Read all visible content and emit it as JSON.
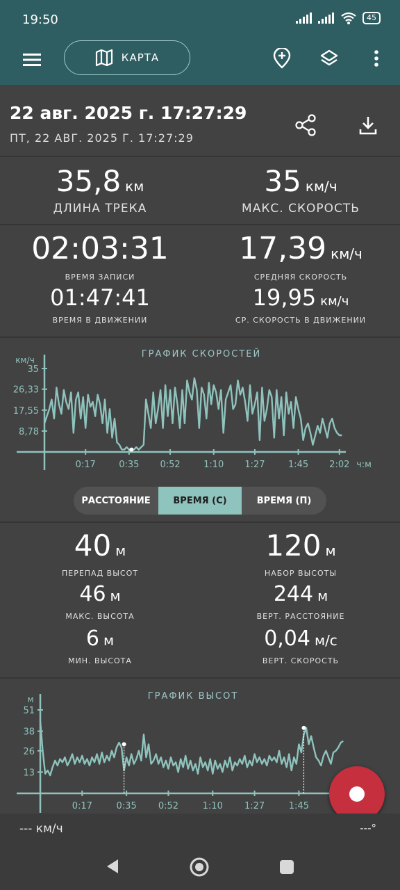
{
  "status": {
    "time": "19:50",
    "battery": "45"
  },
  "appbar": {
    "map_label": "КАРТА",
    "icons": [
      "menu-icon",
      "map-icon",
      "add-location-icon",
      "layers-icon",
      "more-vert-icon"
    ]
  },
  "header": {
    "title": "22 авг. 2025 г. 17:27:29",
    "subtitle": "ПТ, 22 АВГ. 2025 Г. 17:27:29"
  },
  "stats": {
    "distance": {
      "value": "35,8",
      "unit": "км",
      "label": "ДЛИНА ТРЕКА"
    },
    "max_speed": {
      "value": "35",
      "unit": "км/ч",
      "label": "МАКС. СКОРОСТЬ"
    },
    "rec_time": {
      "value": "02:03:31",
      "label": "ВРЕМЯ ЗАПИСИ"
    },
    "avg_speed": {
      "value": "17,39",
      "unit": "км/ч",
      "label": "СРЕДНЯЯ СКОРОСТЬ"
    },
    "moving_time": {
      "value": "01:47:41",
      "label": "ВРЕМЯ В ДВИЖЕНИИ"
    },
    "moving_avg": {
      "value": "19,95",
      "unit": "км/ч",
      "label": "СР. СКОРОСТЬ В ДВИЖЕНИИ"
    }
  },
  "speed_chart_title": "ГРАФИК СКОРОСТЕЙ",
  "segmented": {
    "distance": "РАССТОЯНИЕ",
    "time_s": "ВРЕМЯ (С)",
    "time_p": "ВРЕМЯ (П)"
  },
  "elevation": {
    "diff": {
      "value": "40",
      "unit": "м",
      "label": "ПЕРЕПАД ВЫСОТ"
    },
    "gain": {
      "value": "120",
      "unit": "м",
      "label": "НАБОР ВЫСОТЫ"
    },
    "max": {
      "value": "46",
      "unit": "м",
      "label": "МАКС. ВЫСОТА"
    },
    "vdist": {
      "value": "244",
      "unit": "м",
      "label": "ВЕРТ. РАССТОЯНИЕ"
    },
    "min": {
      "value": "6",
      "unit": "м",
      "label": "МИН. ВЫСОТА"
    },
    "vspeed": {
      "value": "0,04",
      "unit": "м/с",
      "label": "ВЕРТ. СКОРОСТЬ"
    }
  },
  "elevation_chart_title": "ГРАФИК ВЫСОТ",
  "bottom": {
    "speed": "--- км/ч",
    "heading": "---°"
  },
  "chart_data": [
    {
      "type": "line",
      "title": "ГРАФИК СКОРОСТЕЙ",
      "ylabel": "км/ч",
      "xlabel": "ч:м",
      "y_ticks": [
        "35",
        "26,33",
        "17,55",
        "8,78"
      ],
      "x_ticks": [
        "0:17",
        "0:35",
        "0:52",
        "1:10",
        "1:27",
        "1:45",
        "2:02"
      ],
      "ylim": [
        0,
        35
      ],
      "xlim_minutes": [
        0,
        123.5
      ],
      "color": "#8fc3bd",
      "series": [
        {
          "x": [
            0,
            2,
            3,
            4,
            5,
            6,
            7,
            8,
            9,
            10,
            11,
            12,
            13,
            14,
            15,
            16,
            17,
            18,
            19,
            20,
            21,
            22,
            23,
            24,
            25,
            26,
            27,
            28,
            29,
            30,
            31,
            32,
            33,
            34,
            35,
            36,
            37,
            38,
            39,
            40,
            41,
            42,
            43,
            44,
            45,
            46,
            47,
            48,
            49,
            50,
            51,
            52,
            53,
            54,
            55,
            56,
            57,
            58,
            59,
            60,
            61,
            62,
            63,
            64,
            65,
            66,
            67,
            68,
            69,
            70,
            71,
            72,
            73,
            74,
            75,
            76,
            77,
            78,
            79,
            80,
            81,
            82,
            83,
            84,
            85,
            86,
            87,
            88,
            89,
            90,
            91,
            92,
            93,
            94,
            95,
            96,
            97,
            98,
            99,
            100,
            101,
            102,
            103,
            104,
            105,
            106,
            107,
            108,
            109,
            110,
            111,
            112,
            113,
            114,
            115,
            116,
            117,
            118,
            119,
            120,
            121,
            122,
            123
          ],
          "values": [
            12,
            18,
            22,
            14,
            27,
            20,
            16,
            26,
            21,
            18,
            25,
            8,
            22,
            25,
            14,
            23,
            10,
            24,
            19,
            21,
            15,
            24,
            20,
            12,
            22,
            8,
            18,
            6,
            14,
            4,
            3,
            1,
            1,
            2,
            1,
            1,
            1,
            2,
            1,
            2,
            3,
            22,
            16,
            10,
            25,
            12,
            18,
            26,
            10,
            28,
            15,
            26,
            12,
            27,
            20,
            10,
            26,
            12,
            30,
            25,
            22,
            31,
            26,
            10,
            27,
            24,
            14,
            29,
            20,
            28,
            25,
            18,
            26,
            8,
            22,
            25,
            28,
            18,
            20,
            30,
            24,
            27,
            21,
            13,
            28,
            16,
            20,
            25,
            5,
            27,
            13,
            18,
            26,
            23,
            6,
            26,
            14,
            23,
            7,
            25,
            16,
            21,
            10,
            23,
            18,
            14,
            5,
            10,
            12,
            8,
            3,
            7,
            11,
            8,
            14,
            10,
            6,
            12,
            14,
            10,
            8,
            7,
            7
          ],
          "marker": {
            "x": 36,
            "y": 1
          }
        }
      ]
    },
    {
      "type": "line",
      "title": "ГРАФИК ВЫСОТ",
      "ylabel": "м",
      "y_ticks": [
        "51",
        "38",
        "26",
        "13"
      ],
      "x_ticks": [
        "0:17",
        "0:35",
        "0:52",
        "1:10",
        "1:27",
        "1:45"
      ],
      "ylim": [
        0,
        51
      ],
      "color": "#8fc3bd",
      "series": [
        {
          "x": [
            0,
            1,
            2,
            3,
            4,
            5,
            6,
            7,
            8,
            9,
            10,
            11,
            12,
            13,
            14,
            15,
            16,
            17,
            18,
            19,
            20,
            21,
            22,
            23,
            24,
            25,
            26,
            27,
            28,
            29,
            30,
            31,
            32,
            33,
            34,
            35,
            36,
            37,
            38,
            39,
            40,
            41,
            42,
            43,
            44,
            45,
            46,
            47,
            48,
            49,
            50,
            51,
            52,
            53,
            54,
            55,
            56,
            57,
            58,
            59,
            60,
            61,
            62,
            63,
            64,
            65,
            66,
            67,
            68,
            69,
            70,
            71,
            72,
            73,
            74,
            75,
            76,
            77,
            78,
            79,
            80,
            81,
            82,
            83,
            84,
            85,
            86,
            87,
            88,
            89,
            90,
            91,
            92,
            93,
            94,
            95,
            96,
            97,
            98,
            99,
            100,
            101,
            102,
            103,
            104,
            105,
            106,
            107,
            108,
            109,
            110,
            111,
            112,
            113,
            114,
            115,
            116,
            117,
            118,
            119,
            120,
            121,
            122,
            123
          ],
          "values": [
            44,
            26,
            12,
            14,
            11,
            16,
            20,
            17,
            21,
            19,
            22,
            17,
            20,
            24,
            18,
            22,
            19,
            23,
            18,
            21,
            17,
            22,
            19,
            24,
            18,
            25,
            19,
            23,
            20,
            26,
            22,
            28,
            31,
            28,
            14,
            22,
            17,
            24,
            18,
            21,
            26,
            20,
            36,
            22,
            30,
            18,
            20,
            24,
            18,
            22,
            16,
            20,
            15,
            22,
            17,
            19,
            13,
            21,
            16,
            23,
            15,
            20,
            14,
            18,
            12,
            22,
            16,
            19,
            14,
            21,
            12,
            20,
            15,
            18,
            13,
            20,
            16,
            22,
            14,
            19,
            17,
            21,
            18,
            23,
            16,
            20,
            17,
            24,
            19,
            22,
            18,
            21,
            17,
            23,
            20,
            22,
            19,
            26,
            18,
            22,
            16,
            24,
            14,
            22,
            18,
            30,
            25,
            36,
            40,
            30,
            35,
            28,
            22,
            20,
            17,
            23,
            26,
            22,
            18,
            25,
            26,
            28,
            31,
            32
          ],
          "marker": {
            "x": 34,
            "y": 30
          },
          "marker2": {
            "x": 107,
            "y": 40
          }
        }
      ]
    }
  ]
}
